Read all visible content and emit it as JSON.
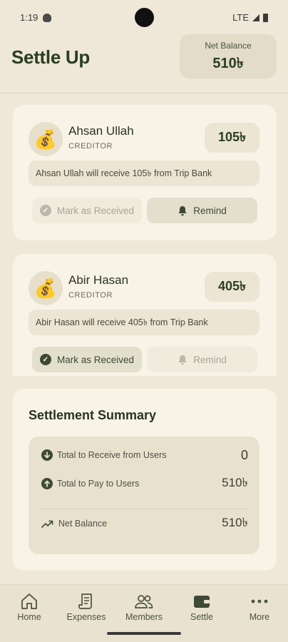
{
  "status": {
    "time": "1:19",
    "network": "LTE"
  },
  "header": {
    "title": "Settle Up",
    "net_balance_label": "Net Balance",
    "net_balance_value": "510৳"
  },
  "settlements": [
    {
      "name": "Ahsan Ullah",
      "role": "CREDITOR",
      "amount": "105৳",
      "message": "Ahsan Ullah will receive 105৳ from Trip Bank",
      "mark_label": "Mark as Received",
      "remind_label": "Remind",
      "avatar_icon": "money-bag-icon"
    },
    {
      "name": "Abir Hasan",
      "role": "CREDITOR",
      "amount": "405৳",
      "message": "Abir Hasan will receive 405৳ from Trip Bank",
      "mark_label": "Mark as Received",
      "remind_label": "Remind",
      "avatar_icon": "money-bag-icon"
    }
  ],
  "summary": {
    "title": "Settlement Summary",
    "rows": [
      {
        "label": "Total to Receive from Users",
        "value": "0",
        "icon": "arrow-down-circle-icon"
      },
      {
        "label": "Total to Pay to Users",
        "value": "510৳",
        "icon": "arrow-up-circle-icon"
      },
      {
        "label": "Net Balance",
        "value": "510৳",
        "icon": "trending-up-icon"
      }
    ]
  },
  "nav": {
    "items": [
      {
        "label": "Home",
        "icon": "home-icon"
      },
      {
        "label": "Expenses",
        "icon": "receipt-icon"
      },
      {
        "label": "Members",
        "icon": "members-icon"
      },
      {
        "label": "Settle",
        "icon": "wallet-icon"
      },
      {
        "label": "More",
        "icon": "more-icon"
      }
    ],
    "active": "Settle"
  },
  "colors": {
    "accent": "#2a3d22",
    "background": "#efe8d8",
    "card": "#f8f3e7"
  }
}
